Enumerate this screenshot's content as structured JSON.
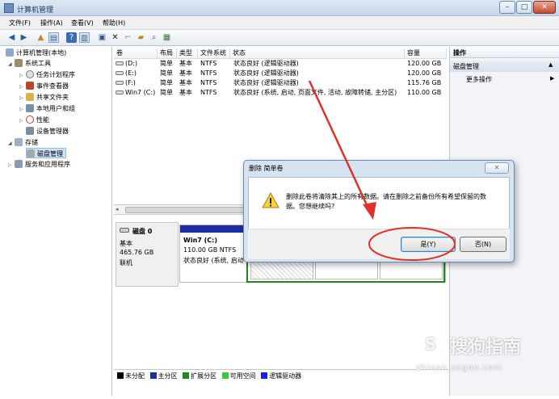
{
  "window": {
    "title": "计算机管理",
    "min": "–",
    "max": "□",
    "close": "✕"
  },
  "menu": [
    "文件(F)",
    "操作(A)",
    "查看(V)",
    "帮助(H)"
  ],
  "tree": {
    "root": "计算机管理(本地)",
    "system_tools": "系统工具",
    "task_scheduler": "任务计划程序",
    "event_viewer": "事件查看器",
    "shared_folders": "共享文件夹",
    "local_users": "本地用户和组",
    "performance": "性能",
    "device_manager": "设备管理器",
    "storage": "存储",
    "disk_management": "磁盘管理",
    "services_apps": "服务和应用程序"
  },
  "volumes": {
    "headers": [
      "卷",
      "布局",
      "类型",
      "文件系统",
      "状态",
      "容量"
    ],
    "rows": [
      [
        "(D:)",
        "简单",
        "基本",
        "NTFS",
        "状态良好 (逻辑驱动器)",
        "120.00 GB"
      ],
      [
        "(E:)",
        "简单",
        "基本",
        "NTFS",
        "状态良好 (逻辑驱动器)",
        "120.00 GB"
      ],
      [
        "(F:)",
        "简单",
        "基本",
        "NTFS",
        "状态良好 (逻辑驱动器)",
        "115.76 GB"
      ],
      [
        "Win7 (C:)",
        "简单",
        "基本",
        "NTFS",
        "状态良好 (系统, 启动, 页面文件, 活动, 故障转储, 主分区)",
        "110.00 GB"
      ]
    ]
  },
  "disk": {
    "name": "磁盘 0",
    "type": "基本",
    "size": "465.76 GB",
    "status": "联机",
    "partition_name": "Win7  (C:)",
    "partition_size": "110.00 GB NTFS",
    "partition_status": "状态良好 (系统, 启动"
  },
  "legend": [
    {
      "label": "未分配",
      "color": "#000000"
    },
    {
      "label": "主分区",
      "color": "#1b2ea0"
    },
    {
      "label": "扩展分区",
      "color": "#1e8a1e"
    },
    {
      "label": "可用空间",
      "color": "#3cc83c"
    },
    {
      "label": "逻辑驱动器",
      "color": "#1a1aff"
    }
  ],
  "actions": {
    "header": "操作",
    "section": "磁盘管理",
    "more": "更多操作"
  },
  "dialog": {
    "title": "删除 简单卷",
    "message": "删除此卷将清除其上的所有数据。请在删除之前备份所有希望保留的数据。您想继续吗?",
    "yes": "是(Y)",
    "no": "否(N)",
    "close": "✕"
  },
  "watermark": {
    "brand": "搜狗指南",
    "url": "zhinan.sogou.com"
  },
  "colors": {
    "annotation": "#e0322b",
    "primary_partition": "#1b2ea0",
    "selection": "#cde4f7"
  }
}
